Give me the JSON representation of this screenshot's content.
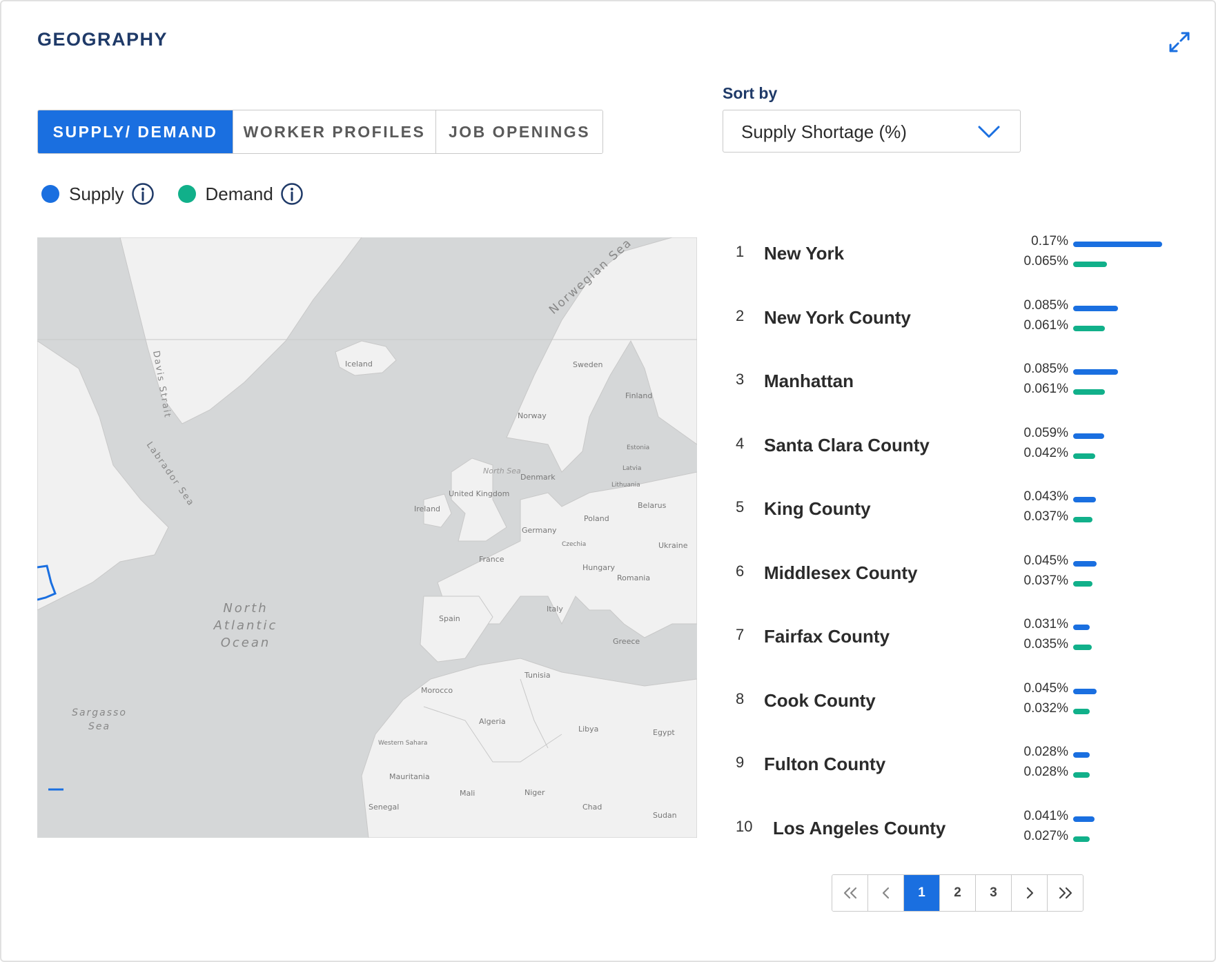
{
  "header": {
    "title": "GEOGRAPHY",
    "expand_icon": "expand-arrows-icon"
  },
  "tabs": [
    {
      "label": "SUPPLY/ DEMAND",
      "active": true
    },
    {
      "label": "WORKER PROFILES",
      "active": false
    },
    {
      "label": "JOB OPENINGS",
      "active": false
    }
  ],
  "sort": {
    "label": "Sort by",
    "value": "Supply Shortage (%)",
    "icon": "chevron-down-icon"
  },
  "legend": [
    {
      "label": "Supply",
      "color": "#1a6fe0",
      "icon": "info-icon"
    },
    {
      "label": "Demand",
      "color": "#11b08a",
      "icon": "info-icon"
    }
  ],
  "map": {
    "labels": {
      "norwegian_sea": "Norwegian Sea",
      "iceland": "Iceland",
      "sweden": "Sweden",
      "finland": "Finland",
      "norway": "Norway",
      "davis_strait": "Davis Strait",
      "labrador_sea": "Labrador Sea",
      "denmark": "Denmark",
      "north_sea": "North Sea",
      "estonia": "Estonia",
      "latvia": "Latvia",
      "lithuania": "Lithuania",
      "belarus": "Belarus",
      "united_kingdom": "United Kingdom",
      "ireland": "Ireland",
      "poland": "Poland",
      "germany": "Germany",
      "ukraine": "Ukraine",
      "france": "France",
      "czechia": "Czechia",
      "hungary": "Hungary",
      "romania": "Romania",
      "north_atlantic_ocean": [
        "North",
        "Atlantic",
        "Ocean"
      ],
      "spain": "Spain",
      "italy": "Italy",
      "greece": "Greece",
      "tunisia": "Tunisia",
      "morocco": "Morocco",
      "algeria": "Algeria",
      "libya": "Libya",
      "egypt": "Egypt",
      "sargasso_sea": [
        "Sargasso",
        "Sea"
      ],
      "western_sahara": "Western Sahara",
      "mauritania": "Mauritania",
      "mali": "Mali",
      "niger": "Niger",
      "chad": "Chad",
      "sudan": "Sudan",
      "senegal": "Senegal"
    }
  },
  "ranking": [
    {
      "rank": "1",
      "name": "New York",
      "supply": "0.17%",
      "demand": "0.065%",
      "supply_value": 0.17,
      "demand_value": 0.065
    },
    {
      "rank": "2",
      "name": "New York County",
      "supply": "0.085%",
      "demand": "0.061%",
      "supply_value": 0.085,
      "demand_value": 0.061
    },
    {
      "rank": "3",
      "name": "Manhattan",
      "supply": "0.085%",
      "demand": "0.061%",
      "supply_value": 0.085,
      "demand_value": 0.061
    },
    {
      "rank": "4",
      "name": "Santa Clara County",
      "supply": "0.059%",
      "demand": "0.042%",
      "supply_value": 0.059,
      "demand_value": 0.042
    },
    {
      "rank": "5",
      "name": "King County",
      "supply": "0.043%",
      "demand": "0.037%",
      "supply_value": 0.043,
      "demand_value": 0.037
    },
    {
      "rank": "6",
      "name": "Middlesex County",
      "supply": "0.045%",
      "demand": "0.037%",
      "supply_value": 0.045,
      "demand_value": 0.037
    },
    {
      "rank": "7",
      "name": "Fairfax County",
      "supply": "0.031%",
      "demand": "0.035%",
      "supply_value": 0.031,
      "demand_value": 0.035
    },
    {
      "rank": "8",
      "name": "Cook County",
      "supply": "0.045%",
      "demand": "0.032%",
      "supply_value": 0.045,
      "demand_value": 0.032
    },
    {
      "rank": "9",
      "name": "Fulton County",
      "supply": "0.028%",
      "demand": "0.028%",
      "supply_value": 0.028,
      "demand_value": 0.028
    },
    {
      "rank": "10",
      "name": "Los Angeles County",
      "supply": "0.041%",
      "demand": "0.027%",
      "supply_value": 0.041,
      "demand_value": 0.027
    }
  ],
  "pagination": {
    "pages": [
      "1",
      "2",
      "3"
    ],
    "current": "1",
    "first_icon": "double-chevron-left-icon",
    "prev_icon": "chevron-left-icon",
    "next_icon": "chevron-right-icon",
    "last_icon": "double-chevron-right-icon"
  }
}
